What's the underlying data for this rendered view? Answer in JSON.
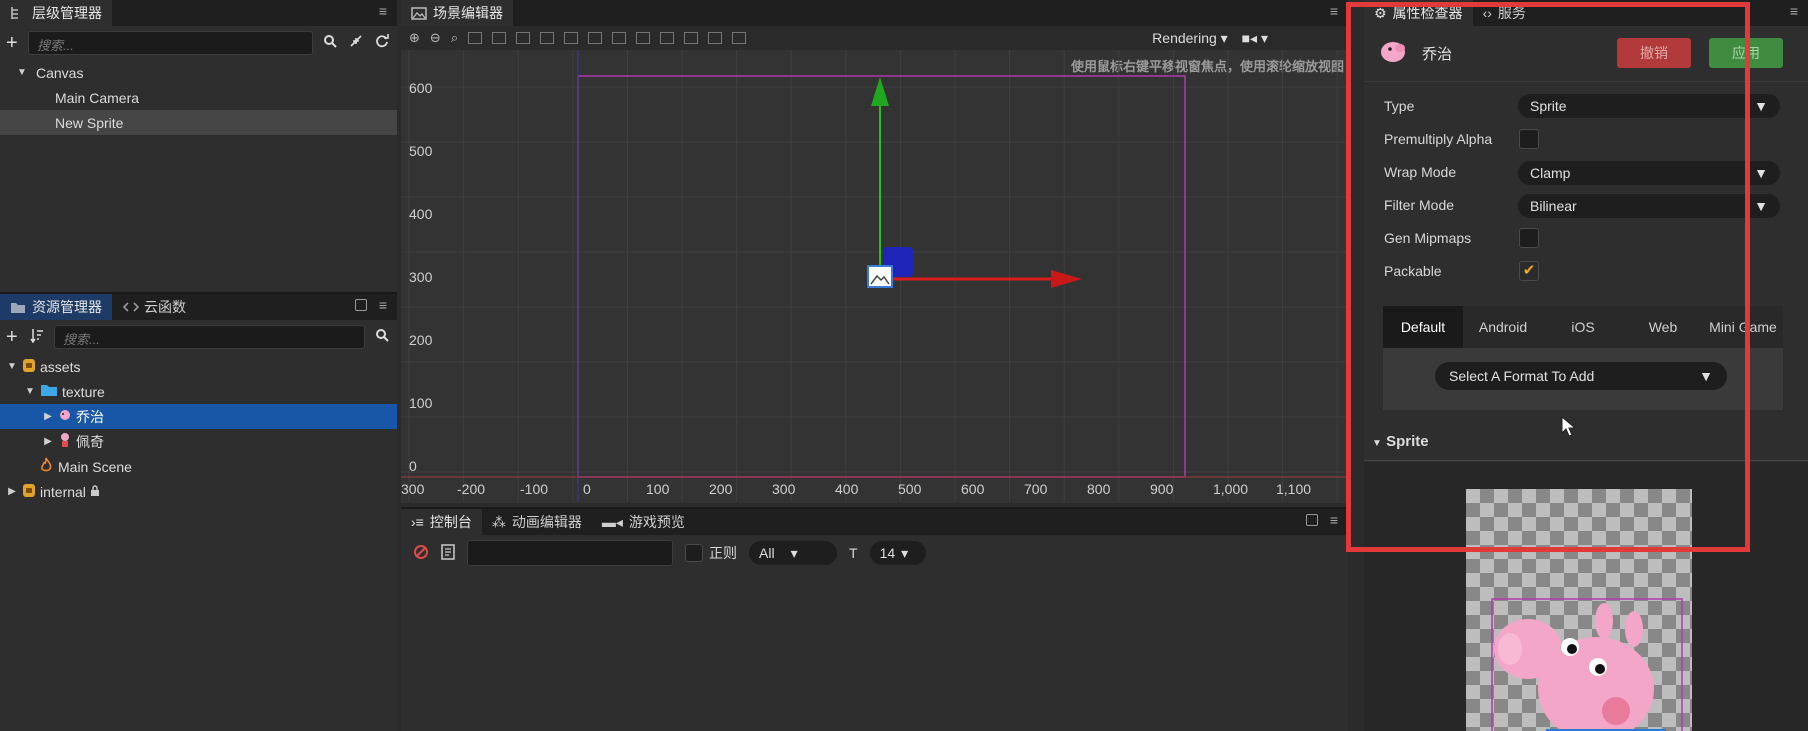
{
  "hierarchy": {
    "tab_label": "层级管理器",
    "search_placeholder": "搜索...",
    "tree": [
      {
        "label": "Canvas"
      },
      {
        "label": "Main Camera"
      },
      {
        "label": "New Sprite"
      }
    ]
  },
  "assets": {
    "tab_label": "资源管理器",
    "tab2_label": "云函数",
    "search_placeholder": "搜索...",
    "tree": [
      {
        "label": "assets"
      },
      {
        "label": "texture"
      },
      {
        "label": "乔治"
      },
      {
        "label": "佩奇"
      },
      {
        "label": "Main Scene"
      },
      {
        "label": "internal"
      }
    ]
  },
  "scene": {
    "tab_label": "场景编辑器",
    "rendering_label": "Rendering",
    "hint": "使用鼠标右键平移视窗焦点，使用滚轮缩放视图",
    "y_ticks": [
      "600",
      "500",
      "400",
      "300",
      "200",
      "100",
      "0"
    ],
    "x_ticks": [
      "300",
      "-200",
      "-100",
      "0",
      "100",
      "200",
      "300",
      "400",
      "500",
      "600",
      "700",
      "800",
      "900",
      "1,000",
      "1,100"
    ]
  },
  "console": {
    "tabs": [
      "控制台",
      "动画编辑器",
      "游戏预览"
    ],
    "regex_label": "正则",
    "level_select": "All",
    "font_size": "14"
  },
  "inspector": {
    "tab_label": "属性检查器",
    "tab2_label": "服务",
    "asset_name": "乔治",
    "revert_label": "撤销",
    "apply_label": "应用",
    "props": {
      "type_label": "Type",
      "type_value": "Sprite",
      "premultiply_label": "Premultiply Alpha",
      "wrap_label": "Wrap Mode",
      "wrap_value": "Clamp",
      "filter_label": "Filter Mode",
      "filter_value": "Bilinear",
      "mipmaps_label": "Gen Mipmaps",
      "packable_label": "Packable"
    },
    "platform_tabs": [
      "Default",
      "Android",
      "iOS",
      "Web",
      "Mini Game"
    ],
    "format_select": "Select A Format To Add",
    "section_label": "Sprite"
  },
  "colors": {
    "selection": "#1857a8",
    "highlight": "#e23a3a",
    "revert": "#b23a3a",
    "apply": "#3f8b3f"
  }
}
